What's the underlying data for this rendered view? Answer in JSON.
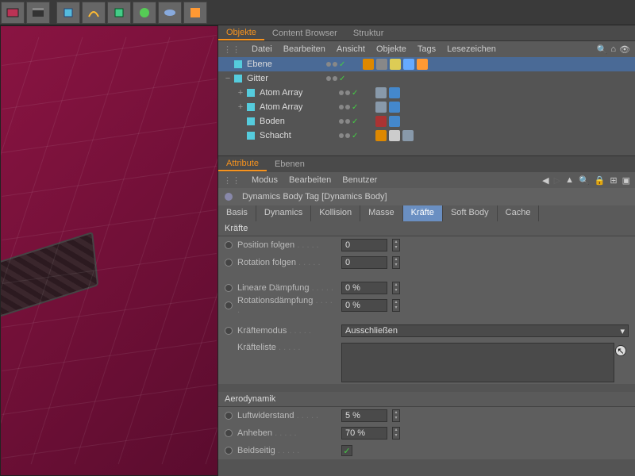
{
  "toolbar_icons": [
    "film",
    "clapper",
    "cube",
    "torus",
    "deform",
    "effector",
    "primitive",
    "render"
  ],
  "obj_tabs": [
    "Objekte",
    "Content Browser",
    "Struktur"
  ],
  "obj_active_tab": 0,
  "obj_menu": [
    "Datei",
    "Bearbeiten",
    "Ansicht",
    "Objekte",
    "Tags",
    "Lesezeichen"
  ],
  "objects": [
    {
      "name": "Ebene",
      "indent": 0,
      "sel": true,
      "expander": "",
      "icon": "plane",
      "tags": [
        "orange",
        "grey",
        "yellow",
        "fx",
        "body-sel"
      ]
    },
    {
      "name": "Gitter",
      "indent": 0,
      "sel": false,
      "expander": "−",
      "icon": "lattice",
      "tags": []
    },
    {
      "name": "Atom Array",
      "indent": 1,
      "sel": false,
      "expander": "+",
      "icon": "atom",
      "tags": [
        "body",
        "softbody"
      ]
    },
    {
      "name": "Atom Array",
      "indent": 1,
      "sel": false,
      "expander": "+",
      "icon": "atom",
      "tags": [
        "body",
        "softbody"
      ]
    },
    {
      "name": "Boden",
      "indent": 1,
      "sel": false,
      "expander": "",
      "icon": "floor",
      "tags": [
        "red",
        "softbody"
      ]
    },
    {
      "name": "Schacht",
      "indent": 1,
      "sel": false,
      "expander": "",
      "icon": "floor",
      "tags": [
        "orange",
        "checker",
        "body"
      ]
    }
  ],
  "attr_tabs": [
    "Attribute",
    "Ebenen"
  ],
  "attr_active_tab": 0,
  "attr_menu": [
    "Modus",
    "Bearbeiten",
    "Benutzer"
  ],
  "tag_title": "Dynamics Body Tag [Dynamics Body]",
  "subtabs": [
    "Basis",
    "Dynamics",
    "Kollision",
    "Masse",
    "Kräfte",
    "Soft Body",
    "Cache"
  ],
  "active_subtab": 4,
  "section1": "Kräfte",
  "section2": "Aerodynamik",
  "params": {
    "position_folgen": {
      "label": "Position folgen",
      "value": "0"
    },
    "rotation_folgen": {
      "label": "Rotation folgen",
      "value": "0"
    },
    "lineare_daempfung": {
      "label": "Lineare Dämpfung",
      "value": "0 %"
    },
    "rotationsdaempfung": {
      "label": "Rotationsdämpfung",
      "value": "0 %"
    },
    "kraeftemodus": {
      "label": "Kräftemodus",
      "value": "Ausschließen"
    },
    "kraefteliste": {
      "label": "Kräfteliste"
    },
    "luftwiderstand": {
      "label": "Luftwiderstand",
      "value": "5 %"
    },
    "anheben": {
      "label": "Anheben",
      "value": "70 %"
    },
    "beidseitig": {
      "label": "Beidseitig",
      "value": true
    }
  }
}
